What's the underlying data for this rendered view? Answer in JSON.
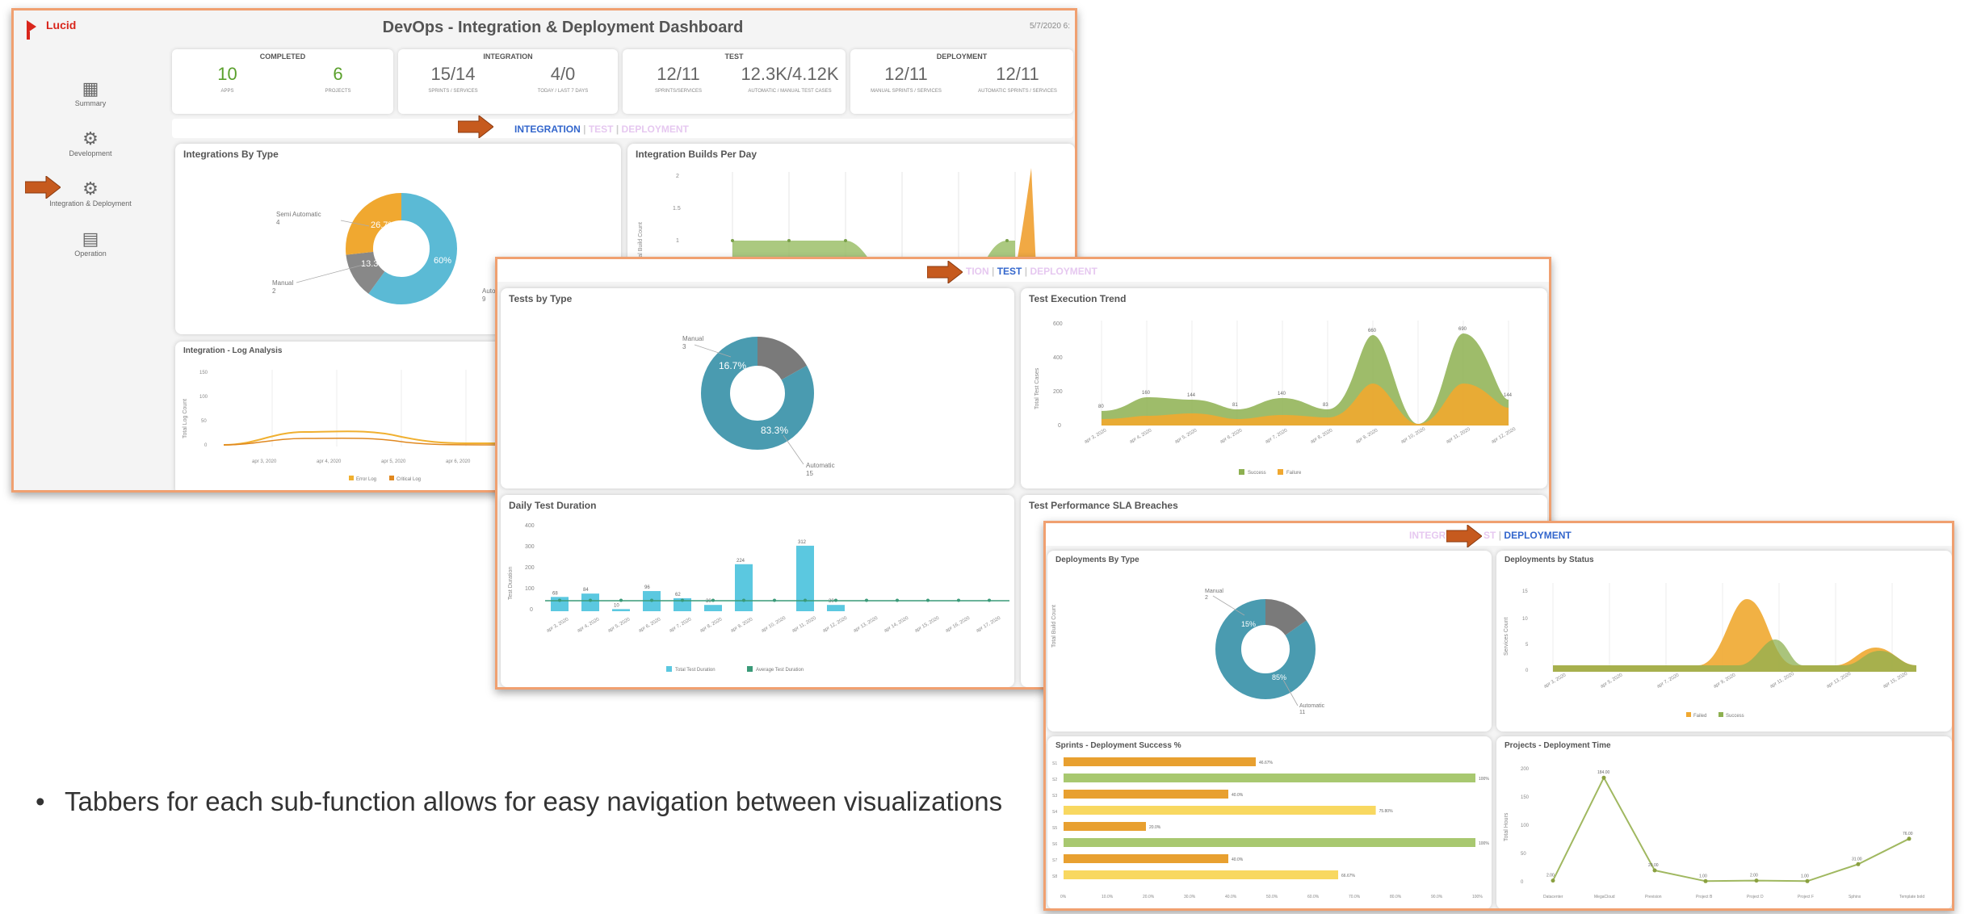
{
  "dashboard": {
    "logo": "Lucid",
    "title": "DevOps - Integration & Deployment Dashboard",
    "date": "5/7/2020 6:",
    "sidebar": [
      "Summary",
      "Development",
      "Integration & Deployment",
      "Operation"
    ],
    "kpis": [
      {
        "group": "COMPLETED",
        "items": [
          {
            "value": "10",
            "label": "APPS"
          },
          {
            "value": "6",
            "label": "PROJECTS"
          }
        ]
      },
      {
        "group": "INTEGRATION",
        "items": [
          {
            "value": "15/14",
            "label": "SPRINTS / SERVICES"
          },
          {
            "value": "4/0",
            "label": "TODAY / LAST 7 DAYS"
          }
        ]
      },
      {
        "group": "TEST",
        "items": [
          {
            "value": "12/11",
            "label": "SPRINTS/SERVICES"
          },
          {
            "value": "12.3K/4.12K",
            "label": "AUTOMATIC / MANUAL TEST CASES"
          }
        ]
      },
      {
        "group": "DEPLOYMENT",
        "items": [
          {
            "value": "12/11",
            "label": "MANUAL SPRINTS / SERVICES"
          },
          {
            "value": "12/11",
            "label": "AUTOMATIC SPRINTS / SERVICES"
          }
        ]
      }
    ],
    "tabs": {
      "integration": "INTEGRATION",
      "test": "TEST",
      "deployment": "DEPLOYMENT"
    },
    "cards": {
      "integrations_by_type": "Integrations By Type",
      "integration_builds": "Integration Builds Per Day",
      "log_analysis": "Integration - Log Analysis"
    },
    "donut_labels": {
      "semi": "Semi Automatic",
      "semi_n": "4",
      "manual": "Manual",
      "manual_n": "2",
      "auto": "Automatic",
      "auto_n": "9"
    },
    "builds_axis": "Total Build Count",
    "log_axis": "Total Log Count",
    "log_legend": [
      "Error Log",
      "Critical Log"
    ]
  },
  "test_panel": {
    "tests_by_type": "Tests by Type",
    "exec_trend": "Test Execution Trend",
    "daily_duration": "Daily Test Duration",
    "sla": "Test Performance SLA Breaches",
    "donut": {
      "manual": "Manual",
      "manual_n": "3",
      "auto": "Automatic",
      "auto_n": "15"
    },
    "trend_axis": "Total Test Cases",
    "trend_legend": [
      "Success",
      "Failure"
    ],
    "duration_axis": "Test Duration",
    "duration_legend": [
      "Total Test Duration",
      "Average Test Duration"
    ]
  },
  "deploy_panel": {
    "by_type": "Deployments By Type",
    "by_status": "Deployments by Status",
    "sprints_success": "Sprints - Deployment Success %",
    "projects_time": "Projects - Deployment Time",
    "donut": {
      "manual": "Manual",
      "manual_n": "2",
      "auto": "Automatic",
      "auto_n": "11"
    },
    "build_axis": "Total Build Count",
    "status_axis": "Services Count",
    "status_legend": [
      "Failed",
      "Success"
    ],
    "time_axis": "Total Hours"
  },
  "bullet_text": "Tabbers for each sub-function allows for easy navigation between visualizations",
  "chart_data": [
    {
      "type": "pie",
      "title": "Integrations By Type",
      "categories": [
        "Automatic",
        "Semi Automatic",
        "Manual"
      ],
      "values": [
        60,
        26.7,
        13.3
      ],
      "labels": [
        "60%",
        "26.7%",
        "13.3%"
      ],
      "colors": [
        "#5bbad5",
        "#f0a830",
        "#888888"
      ]
    },
    {
      "type": "pie",
      "title": "Tests by Type",
      "categories": [
        "Automatic",
        "Manual"
      ],
      "values": [
        83.3,
        16.7
      ],
      "labels": [
        "83.3%",
        "16.7%"
      ],
      "colors": [
        "#4a9bb0",
        "#7a7a7a"
      ]
    },
    {
      "type": "area",
      "title": "Test Execution Trend",
      "categories": [
        "apr 3, 2020",
        "apr 4, 2020",
        "apr 5, 2020",
        "apr 6, 2020",
        "apr 7, 2020",
        "apr 8, 2020",
        "apr 9, 2020",
        "apr 10, 2020",
        "apr 11, 2020",
        "apr 12, 2020"
      ],
      "series": [
        {
          "name": "Success",
          "values": [
            80,
            160,
            144,
            81,
            140,
            83,
            660,
            0,
            690,
            144
          ]
        },
        {
          "name": "Failure",
          "values": [
            30,
            60,
            70,
            40,
            60,
            40,
            250,
            0,
            250,
            100
          ]
        }
      ],
      "ylim": [
        0,
        800
      ],
      "yticks": [
        "0",
        "200",
        "400",
        "600"
      ]
    },
    {
      "type": "bar",
      "title": "Daily Test Duration",
      "categories": [
        "apr 3, 2020",
        "apr 4, 2020",
        "apr 5, 2020",
        "apr 6, 2020",
        "apr 7, 2020",
        "apr 8, 2020",
        "apr 9, 2020",
        "apr 10, 2020",
        "apr 11, 2020",
        "apr 12, 2020",
        "apr 13, 2020",
        "apr 14, 2020",
        "apr 15, 2020",
        "apr 16, 2020",
        "apr 17, 2020"
      ],
      "series": [
        {
          "name": "Total Test Duration",
          "values": [
            68,
            84,
            10,
            96,
            62,
            30,
            224,
            0,
            312,
            30,
            0,
            0,
            0,
            0,
            0
          ]
        },
        {
          "name": "Average Test Duration",
          "values": [
            51.87,
            51.87,
            51.87,
            51.87,
            51.87,
            51.87,
            51.87,
            51.87,
            51.87,
            51.87,
            51.87,
            51.87,
            51.87,
            51.87,
            51.87
          ]
        }
      ],
      "ylim": [
        0,
        400
      ],
      "yticks": [
        "0",
        "100",
        "200",
        "300",
        "400"
      ]
    },
    {
      "type": "bar",
      "title": "Sprints - Deployment Success %",
      "categories": [
        "S1",
        "S2",
        "S3",
        "S4",
        "S5",
        "S6",
        "S7",
        "S8"
      ],
      "values": [
        46.67,
        100,
        40,
        75.8,
        20,
        100,
        40,
        66.67
      ],
      "labels": [
        "46.67%",
        "100%",
        "40.0%",
        "75.80%",
        "20.0%",
        "100%",
        "40.0%",
        "66.67%"
      ],
      "xticks": [
        "0%",
        "10.0%",
        "20.0%",
        "30.0%",
        "40.0%",
        "50.0%",
        "60.0%",
        "70.0%",
        "80.0%",
        "90.0%",
        "100%"
      ]
    },
    {
      "type": "line",
      "title": "Projects - Deployment Time",
      "categories": [
        "Datacenter",
        "MegaCloud",
        "Prevision",
        "Project B",
        "Project D",
        "Project F",
        "Sphinx",
        "Template bold"
      ],
      "values": [
        2,
        184,
        20,
        1,
        2,
        1,
        31,
        76
      ],
      "labels": [
        "2.00",
        "184.00",
        "20.00",
        "1.00",
        "2.00",
        "1.00",
        "31.00",
        "76.00"
      ],
      "yticks": [
        "0",
        "50",
        "100",
        "150",
        "200"
      ]
    }
  ]
}
